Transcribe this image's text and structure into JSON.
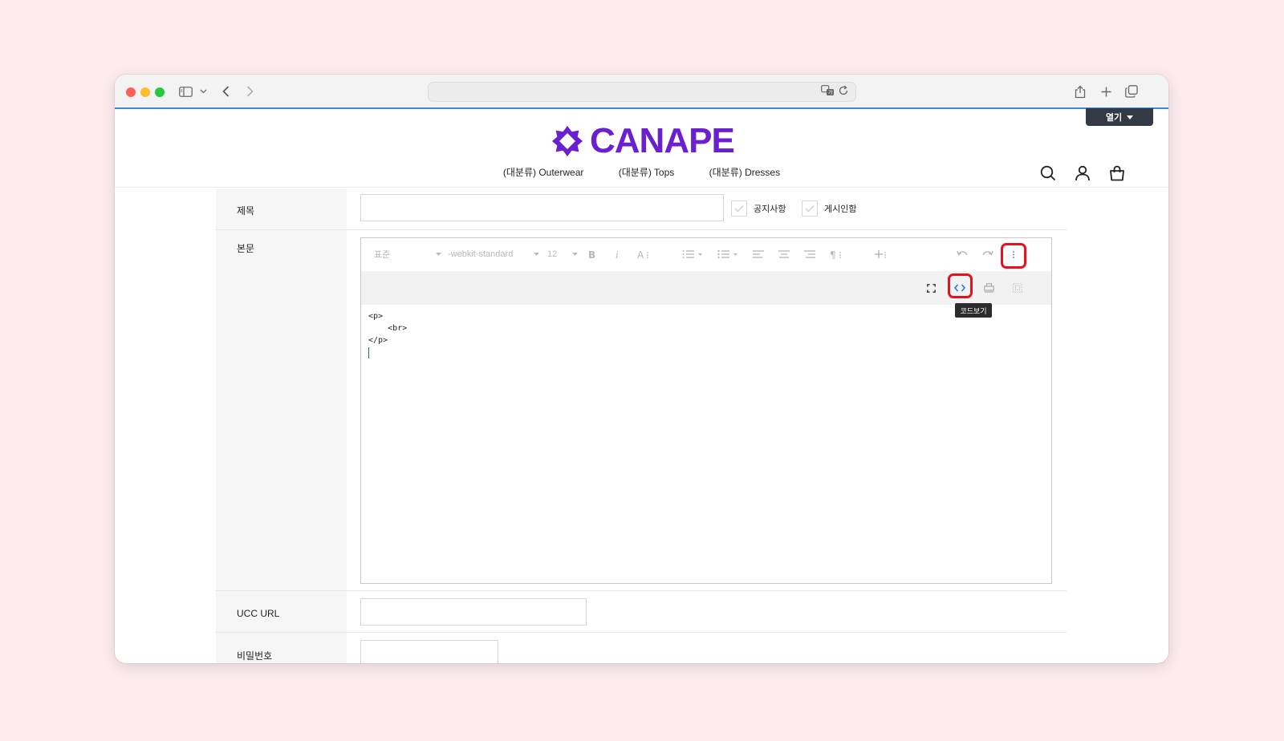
{
  "browser": {
    "address_text": "",
    "icons": [
      "sidebar-icon",
      "chevron-down-icon",
      "back-icon",
      "forward-icon",
      "translate-icon",
      "reload-icon",
      "share-icon",
      "new-tab-icon",
      "tabs-overview-icon"
    ]
  },
  "overlay": {
    "open_label": "열기"
  },
  "site": {
    "logo_text": "CANAPE",
    "brand_color": "#6a1fd1",
    "nav": [
      "(대분류) Outerwear",
      "(대분류) Tops",
      "(대분류) Dresses"
    ],
    "header_icons": [
      "search-icon",
      "user-icon",
      "cart-icon"
    ]
  },
  "form": {
    "title_label": "제목",
    "title_value": "",
    "notice_label": "공지사항",
    "post_confirm_label": "게시인함",
    "body_label": "본문",
    "ucc_label": "UCC URL",
    "ucc_value": "",
    "password_label": "비밀번호",
    "password_value": ""
  },
  "editor": {
    "paragraph_style": "표준",
    "font_family": "-webkit-standard",
    "font_size": "12",
    "tooltip": "코드보기",
    "code_lines": [
      "<p>",
      "    <br>",
      "</p>"
    ],
    "highlight_color": "#e8101a"
  }
}
